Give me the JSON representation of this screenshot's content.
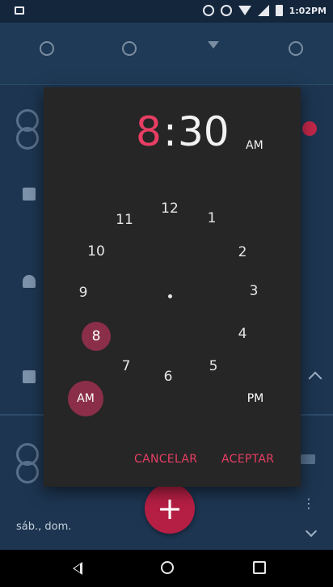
{
  "status_bar": {
    "time": "1:02PM",
    "icons": [
      "screenshot-icon",
      "sync-icon",
      "alarm-icon",
      "wifi-icon",
      "signal-icon",
      "battery-icon"
    ]
  },
  "tabs": [
    "alarm-icon",
    "clock-icon",
    "timer-icon",
    "stopwatch-icon"
  ],
  "background": {
    "bottom_label": "sáb., dom."
  },
  "time_picker": {
    "hour": "8",
    "separator": ":",
    "minute": "30",
    "meridiem": "AM",
    "dial_numbers": [
      "12",
      "1",
      "2",
      "3",
      "4",
      "5",
      "6",
      "7",
      "8",
      "9",
      "10",
      "11"
    ],
    "selected_hour": "8",
    "am_label": "AM",
    "pm_label": "PM",
    "cancel_label": "CANCELAR",
    "accept_label": "ACEPTAR"
  },
  "colors": {
    "accent": "#e83e64",
    "selection": "#8a2e49",
    "dialog_bg": "#262626",
    "app_bg": "#1d3550",
    "fab": "#b51f44"
  },
  "fab": {
    "label": "+"
  },
  "nav_bar": [
    "back-icon",
    "home-icon",
    "recents-icon"
  ]
}
